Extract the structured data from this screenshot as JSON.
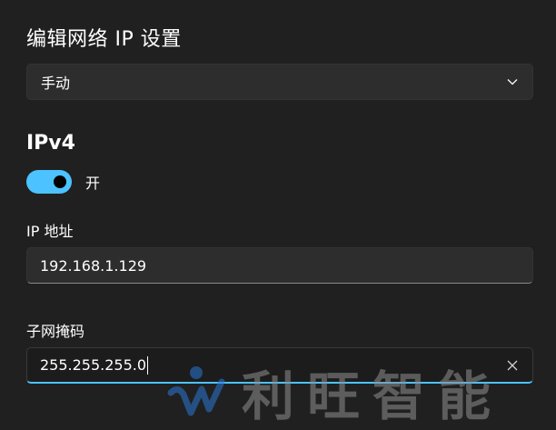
{
  "dialog": {
    "title": "编辑网络 IP 设置",
    "mode_dropdown": {
      "selected": "手动",
      "icon": "chevron-down-icon"
    }
  },
  "ipv4": {
    "heading": "IPv4",
    "toggle": {
      "state": "on",
      "label": "开",
      "accent": "#4cc2ff"
    },
    "ip_address": {
      "label": "IP 地址",
      "value": "192.168.1.129"
    },
    "subnet_mask": {
      "label": "子网掩码",
      "value": "255.255.255.0",
      "clear_icon": "close-icon"
    }
  },
  "watermark": {
    "text": "利旺智能"
  }
}
